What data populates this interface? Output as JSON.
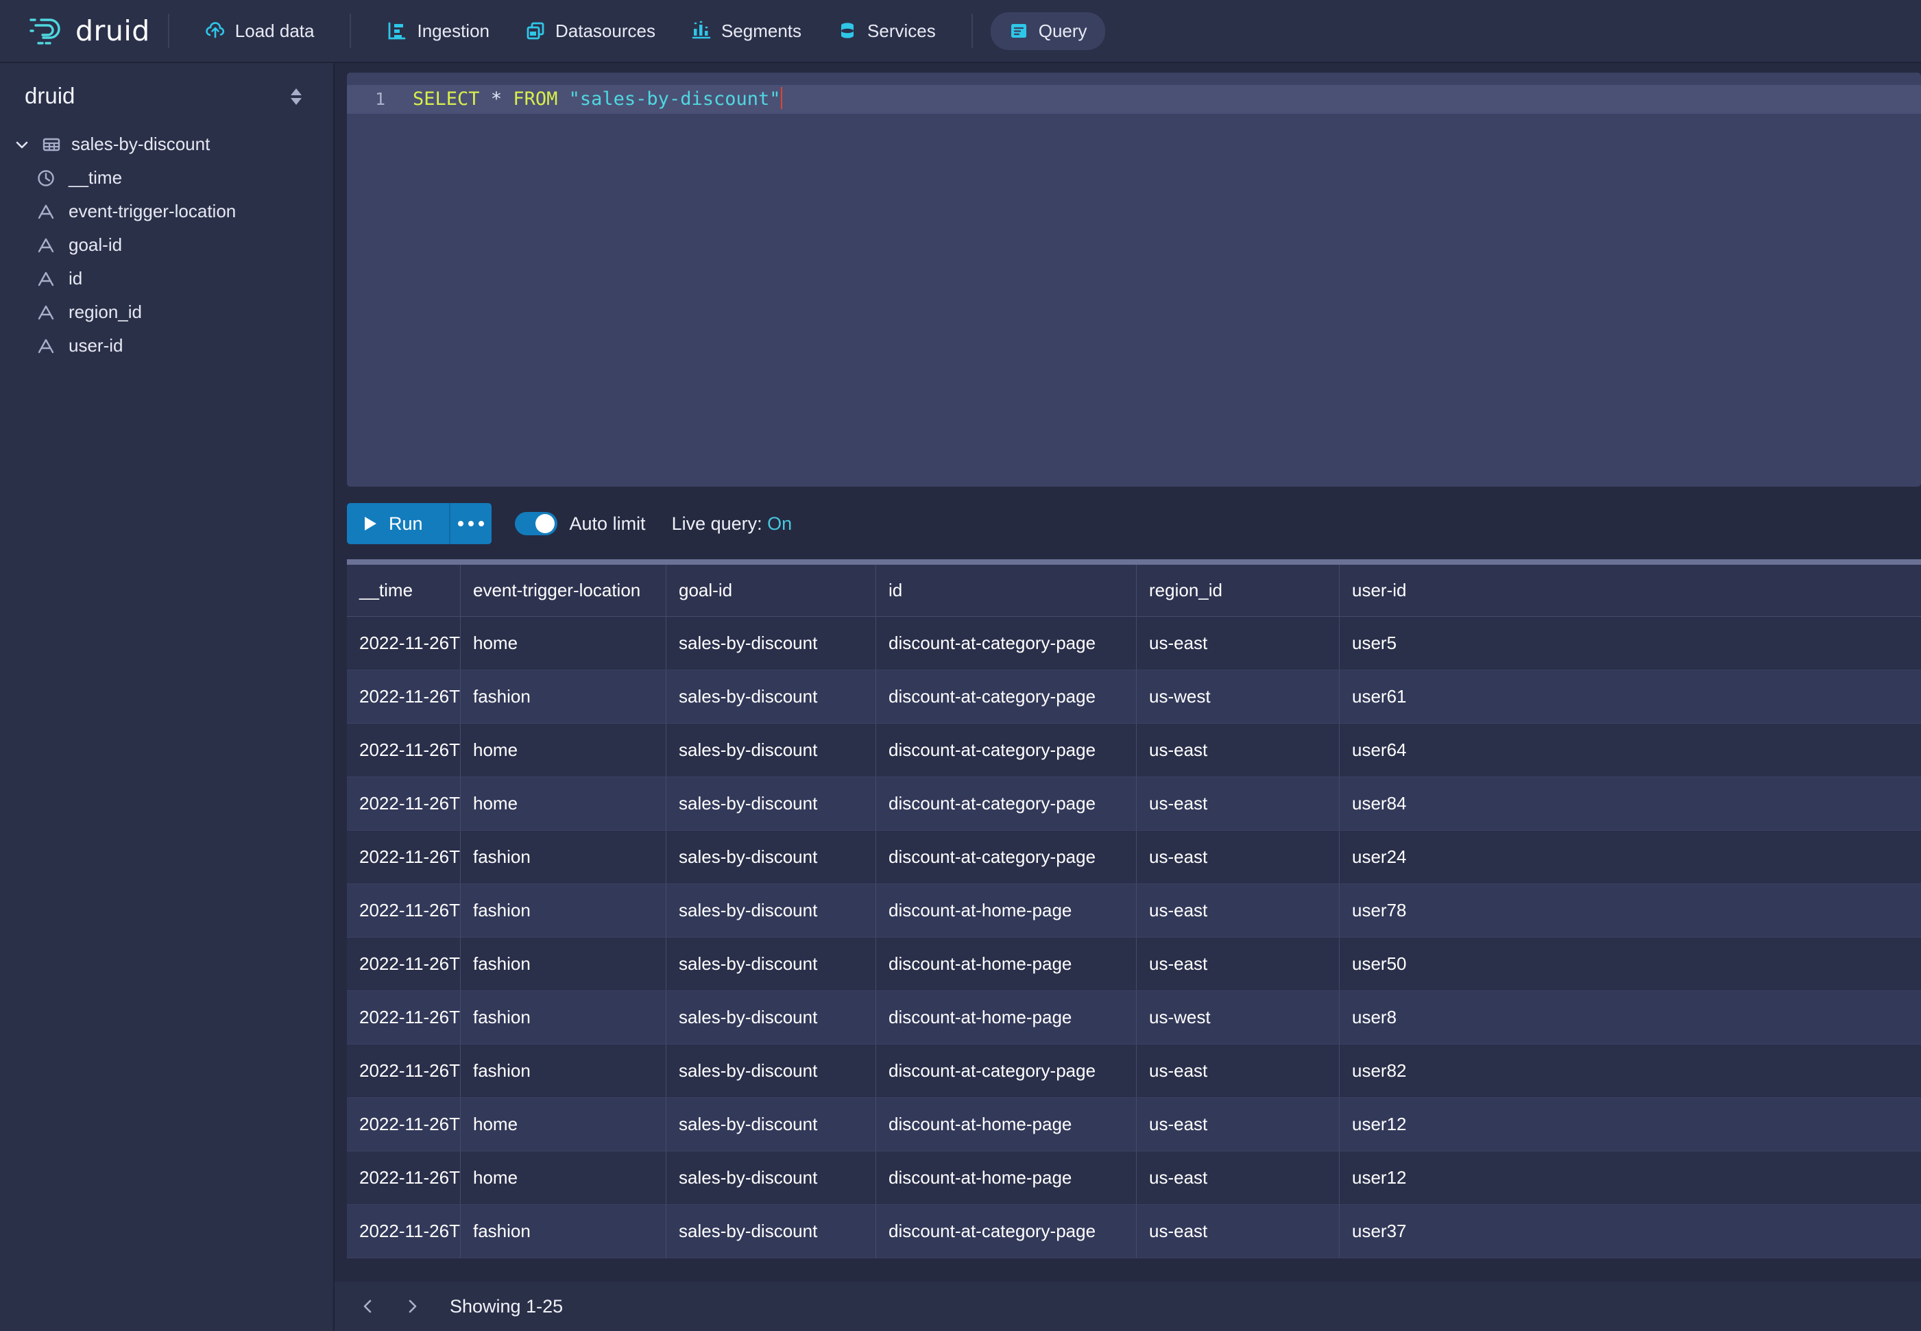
{
  "brand": {
    "name": "druid",
    "logo_icon": "druid-logo-icon"
  },
  "nav": {
    "items": [
      {
        "label": "Load data",
        "icon": "cloud-upload-icon",
        "active": false
      },
      {
        "label": "Ingestion",
        "icon": "ingestion-icon",
        "active": false
      },
      {
        "label": "Datasources",
        "icon": "datasources-icon",
        "active": false
      },
      {
        "label": "Segments",
        "icon": "segments-icon",
        "active": false
      },
      {
        "label": "Services",
        "icon": "database-icon",
        "active": false
      },
      {
        "label": "Query",
        "icon": "query-icon",
        "active": true
      }
    ]
  },
  "sidebar": {
    "title": "druid",
    "sort_icon": "sort-updown-icon",
    "tree": {
      "datasource": {
        "label": "sales-by-discount",
        "icon": "table-icon",
        "chevron": "chevron-down-icon",
        "expanded": true
      },
      "columns": [
        {
          "label": "__time",
          "icon": "clock-icon"
        },
        {
          "label": "event-trigger-location",
          "icon": "string-type-icon"
        },
        {
          "label": "goal-id",
          "icon": "string-type-icon"
        },
        {
          "label": "id",
          "icon": "string-type-icon"
        },
        {
          "label": "region_id",
          "icon": "string-type-icon"
        },
        {
          "label": "user-id",
          "icon": "string-type-icon"
        }
      ]
    }
  },
  "editor": {
    "line_number": "1",
    "sql": {
      "keyword1": "SELECT",
      "star": "*",
      "keyword2": "FROM",
      "table": "\"sales-by-discount\""
    }
  },
  "toolbar": {
    "run_label": "Run",
    "run_icon": "play-icon",
    "more_icon": "more-dots-icon",
    "auto_limit_label": "Auto limit",
    "auto_limit_on": true,
    "live_query_prefix": "Live query:",
    "live_query_value": "On"
  },
  "results": {
    "columns": [
      "__time",
      "event-trigger-location",
      "goal-id",
      "id",
      "region_id",
      "user-id"
    ],
    "rows": [
      [
        "2022-11-26T",
        "home",
        "sales-by-discount",
        "discount-at-category-page",
        "us-east",
        "user5"
      ],
      [
        "2022-11-26T",
        "fashion",
        "sales-by-discount",
        "discount-at-category-page",
        "us-west",
        "user61"
      ],
      [
        "2022-11-26T",
        "home",
        "sales-by-discount",
        "discount-at-category-page",
        "us-east",
        "user64"
      ],
      [
        "2022-11-26T",
        "home",
        "sales-by-discount",
        "discount-at-category-page",
        "us-east",
        "user84"
      ],
      [
        "2022-11-26T",
        "fashion",
        "sales-by-discount",
        "discount-at-category-page",
        "us-east",
        "user24"
      ],
      [
        "2022-11-26T",
        "fashion",
        "sales-by-discount",
        "discount-at-home-page",
        "us-east",
        "user78"
      ],
      [
        "2022-11-26T",
        "fashion",
        "sales-by-discount",
        "discount-at-home-page",
        "us-east",
        "user50"
      ],
      [
        "2022-11-26T",
        "fashion",
        "sales-by-discount",
        "discount-at-home-page",
        "us-west",
        "user8"
      ],
      [
        "2022-11-26T",
        "fashion",
        "sales-by-discount",
        "discount-at-category-page",
        "us-east",
        "user82"
      ],
      [
        "2022-11-26T",
        "home",
        "sales-by-discount",
        "discount-at-home-page",
        "us-east",
        "user12"
      ],
      [
        "2022-11-26T",
        "home",
        "sales-by-discount",
        "discount-at-home-page",
        "us-east",
        "user12"
      ],
      [
        "2022-11-26T",
        "fashion",
        "sales-by-discount",
        "discount-at-category-page",
        "us-east",
        "user37"
      ]
    ]
  },
  "pagination": {
    "prev_icon": "chevron-left-icon",
    "next_icon": "chevron-right-icon",
    "showing": "Showing 1-25"
  },
  "colors": {
    "accent_cyan": "#4fd8e0",
    "accent_blue": "#137cbd",
    "nav_bg": "#2b3049",
    "body_bg": "#252a41",
    "editor_bg": "#4b5175",
    "keyword": "#d9ef4b",
    "string": "#4fd8e0"
  }
}
